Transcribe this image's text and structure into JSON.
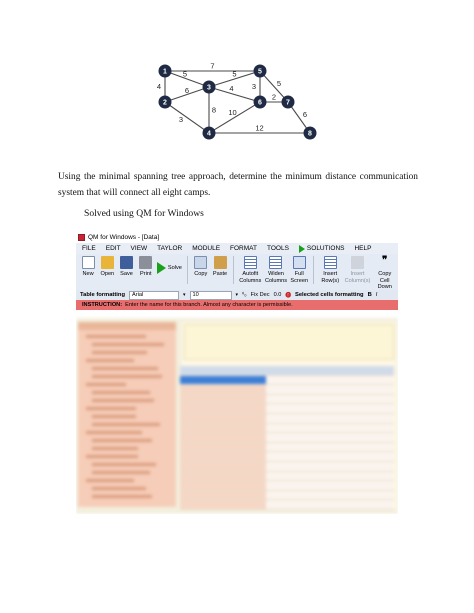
{
  "graph": {
    "nodes": [
      {
        "id": "1",
        "label": "1"
      },
      {
        "id": "2",
        "label": "2"
      },
      {
        "id": "3",
        "label": "3"
      },
      {
        "id": "4",
        "label": "4"
      },
      {
        "id": "5",
        "label": "5"
      },
      {
        "id": "6",
        "label": "6"
      },
      {
        "id": "7",
        "label": "7"
      },
      {
        "id": "8",
        "label": "8"
      }
    ],
    "edges": [
      {
        "from": "1",
        "to": "5",
        "weight": "7"
      },
      {
        "from": "1",
        "to": "3",
        "weight": "5"
      },
      {
        "from": "1",
        "to": "2",
        "weight": "4"
      },
      {
        "from": "2",
        "to": "3",
        "weight": "6"
      },
      {
        "from": "2",
        "to": "4",
        "weight": "3"
      },
      {
        "from": "3",
        "to": "5",
        "weight": "5"
      },
      {
        "from": "3",
        "to": "6",
        "weight": "4"
      },
      {
        "from": "3",
        "to": "4",
        "weight": "8"
      },
      {
        "from": "5",
        "to": "6",
        "weight": "3"
      },
      {
        "from": "5",
        "to": "7",
        "weight": "5"
      },
      {
        "from": "6",
        "to": "7",
        "weight": "2"
      },
      {
        "from": "6",
        "to": "4",
        "weight": "10"
      },
      {
        "from": "7",
        "to": "8",
        "weight": "6"
      },
      {
        "from": "4",
        "to": "8",
        "weight": "12"
      }
    ]
  },
  "text": {
    "paragraph": "Using the minimal spanning tree approach, determine the minimum distance communication system that will connect all eight camps.",
    "subheading": "Solved using QM for Windows"
  },
  "app": {
    "title": "QM for Windows - [Data]",
    "menu": [
      "FILE",
      "EDIT",
      "VIEW",
      "TAYLOR",
      "MODULE",
      "FORMAT",
      "TOOLS",
      "SOLUTIONS",
      "HELP"
    ],
    "toolbar": {
      "new": "New",
      "open": "Open",
      "save": "Save",
      "print": "Print",
      "solve": "Solve",
      "copy": "Copy",
      "paste": "Paste",
      "autofit": "Autofit Columns",
      "widen": "Widen Columns",
      "full_screen": "Full Screen",
      "insert_rows": "Insert Row(s)",
      "insert_columns": "Insert Column(s)",
      "copy_cell_down": "Copy Cell Down"
    },
    "format_bar": {
      "label": "Table formatting",
      "font": "Arial",
      "size": "10",
      "fix_dec": "Fix Dec",
      "dec_value": "0.0",
      "selected_label": "Selected cells formatting",
      "bold": "B",
      "italic": "I"
    },
    "instruction": {
      "label": "INSTRUCTION:",
      "text": "Enter the name for this branch. Almost any character is permissible."
    }
  },
  "colors": {
    "node": "#1f2a44",
    "instruction_bar": "#e86d6d",
    "tree_panel": "#f6cdb8",
    "selected_cell": "#3c7fd9"
  }
}
